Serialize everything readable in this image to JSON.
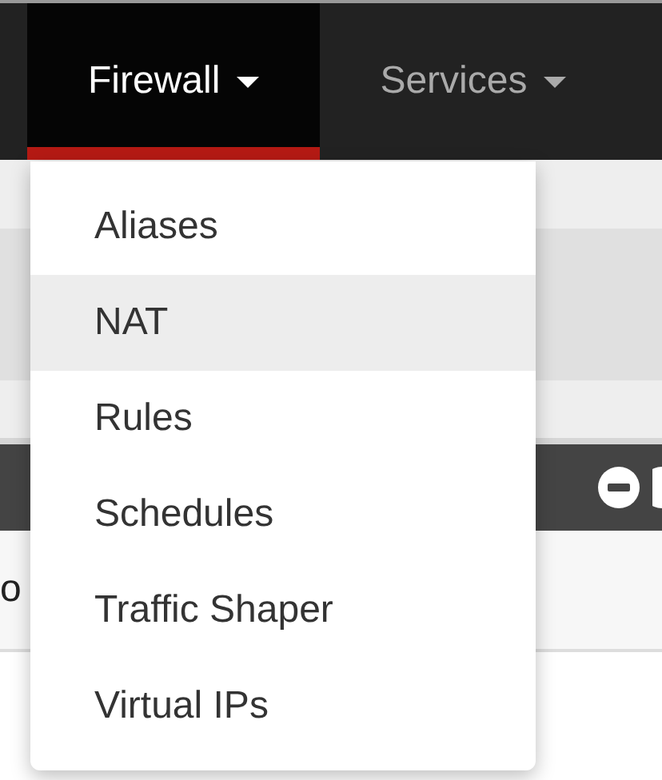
{
  "navbar": {
    "items": [
      {
        "label": "Firewall",
        "selected": true
      },
      {
        "label": "Services",
        "selected": false
      }
    ]
  },
  "dropdown": {
    "items": [
      {
        "label": "Aliases",
        "selected": false
      },
      {
        "label": "NAT",
        "selected": true
      },
      {
        "label": "Rules",
        "selected": false
      },
      {
        "label": "Schedules",
        "selected": false
      },
      {
        "label": "Traffic Shaper",
        "selected": false
      },
      {
        "label": "Virtual IPs",
        "selected": false
      }
    ]
  },
  "background": {
    "panel_text": "o"
  }
}
